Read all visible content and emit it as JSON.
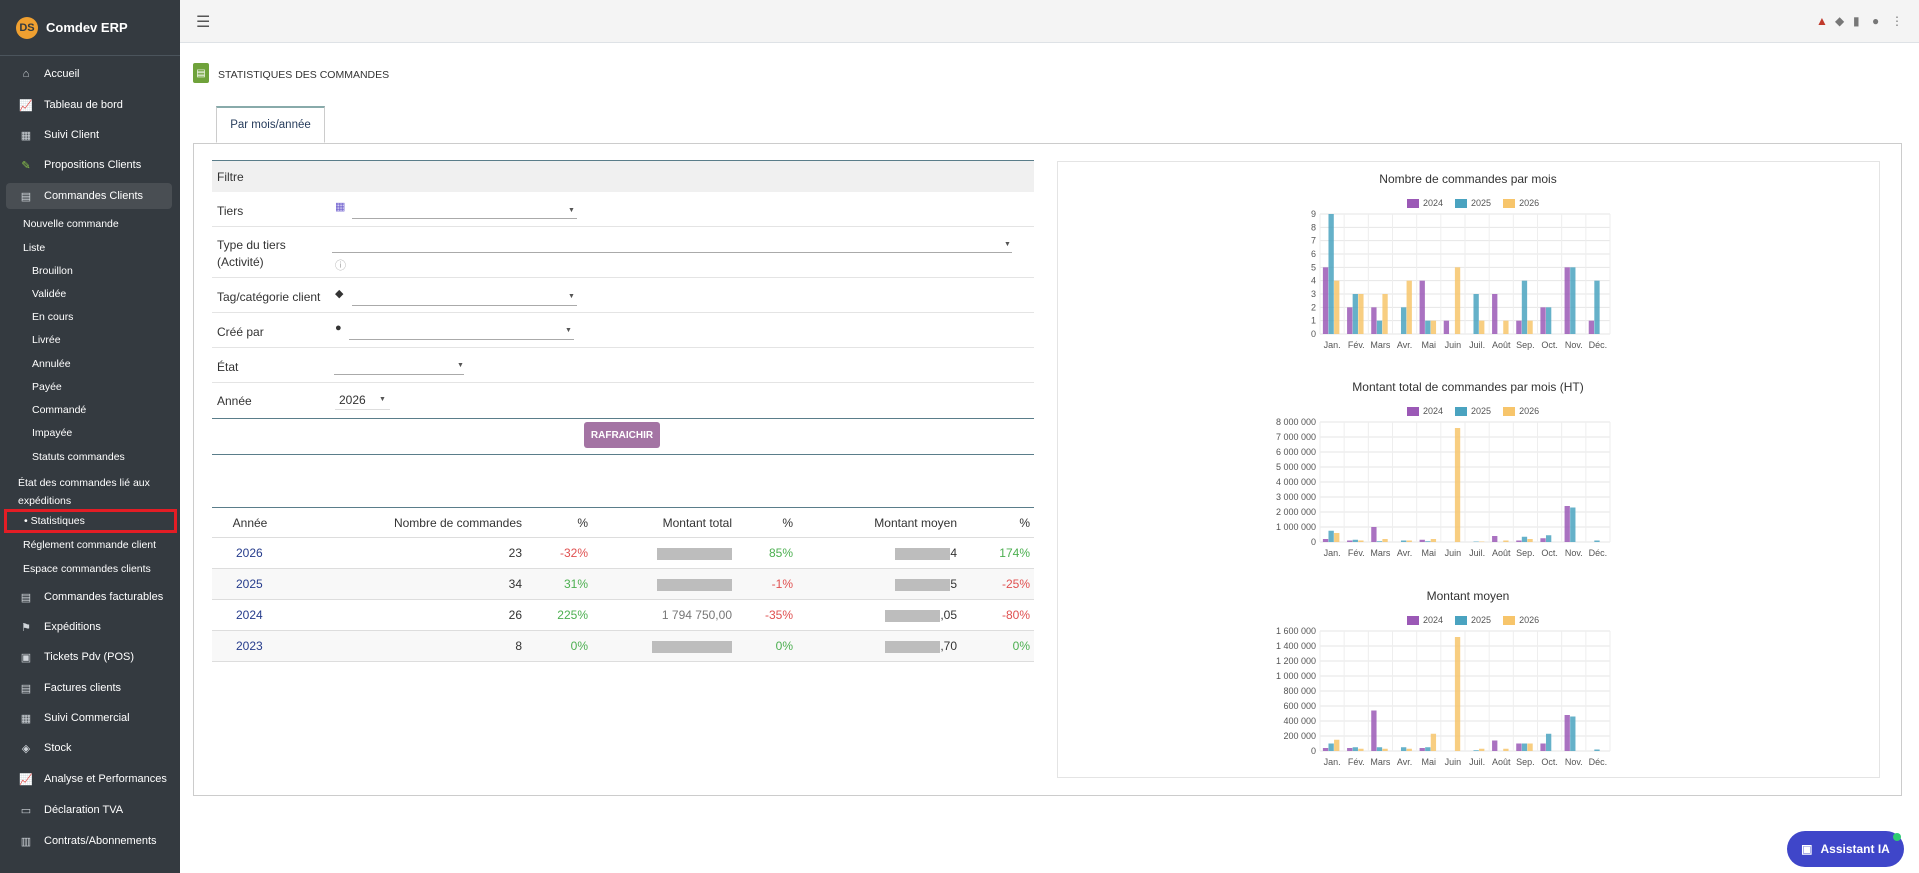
{
  "app": {
    "brand": "Comdev ERP",
    "logo": "DS"
  },
  "sidebar": {
    "items": [
      {
        "label": "Accueil",
        "icon": "home-icon",
        "glyph": "⌂"
      },
      {
        "label": "Tableau de bord",
        "icon": "chart-line-icon",
        "glyph": "📈"
      },
      {
        "label": "Suivi Client",
        "icon": "building-icon",
        "glyph": "▦"
      },
      {
        "label": "Propositions Clients",
        "icon": "edit-icon",
        "glyph": "✎"
      },
      {
        "label": "Commandes Clients",
        "icon": "document-icon",
        "glyph": "▤"
      },
      {
        "label": "Commandes facturables",
        "icon": "document-icon",
        "glyph": "▤"
      },
      {
        "label": "Expéditions",
        "icon": "dolly-icon",
        "glyph": "⚑"
      },
      {
        "label": "Tickets Pdv (POS)",
        "icon": "cash-register-icon",
        "glyph": "▣"
      },
      {
        "label": "Factures clients",
        "icon": "invoice-icon",
        "glyph": "▤"
      },
      {
        "label": "Suivi Commercial",
        "icon": "building-icon",
        "glyph": "▦"
      },
      {
        "label": "Stock",
        "icon": "box-icon",
        "glyph": "◈"
      },
      {
        "label": "Analyse et Performances",
        "icon": "chart-line-icon",
        "glyph": "📈"
      },
      {
        "label": "Déclaration TVA",
        "icon": "id-card-icon",
        "glyph": "▭"
      },
      {
        "label": "Contrats/Abonnements",
        "icon": "briefcase-icon",
        "glyph": "▥"
      }
    ],
    "sub": {
      "nouvelle": "Nouvelle commande",
      "liste": "Liste",
      "statuses": [
        "Brouillon",
        "Validée",
        "En cours",
        "Livrée",
        "Annulée",
        "Payée",
        "Commandé",
        "Impayée",
        "Statuts commandes"
      ],
      "expeditions": "État des commandes lié aux expéditions",
      "statistiques": "Statistiques",
      "reglement": "Réglement commande client",
      "espace": "Espace commandes clients"
    }
  },
  "page": {
    "title": "STATISTIQUES DES COMMANDES",
    "tab": "Par mois/année"
  },
  "filter": {
    "header": "Filtre",
    "tiers": "Tiers",
    "type_tiers": "Type du tiers (Activité)",
    "tag": "Tag/catégorie client",
    "cree_par": "Créé par",
    "etat": "État",
    "annee": "Année",
    "annee_value": "2026",
    "refresh": "RAFRAICHIR"
  },
  "stats": {
    "headers": [
      "Année",
      "Nombre de commandes",
      "%",
      "Montant total",
      "%",
      "Montant moyen",
      "%"
    ],
    "rows": [
      {
        "year": "2026",
        "count": "23",
        "pct1": "-32%",
        "total_visible": "",
        "pct2": "85%",
        "avg_visible": "4",
        "pct3": "174%"
      },
      {
        "year": "2025",
        "count": "34",
        "pct1": "31%",
        "total_visible": "",
        "pct2": "-1%",
        "avg_visible": "5",
        "pct3": "-25%"
      },
      {
        "year": "2024",
        "count": "26",
        "pct1": "225%",
        "total_visible": "1 794 750,00",
        "pct2": "-35%",
        "avg_visible": ",05",
        "pct3": "-80%"
      },
      {
        "year": "2023",
        "count": "8",
        "pct1": "0%",
        "total_visible": "",
        "pct2": "0%",
        "avg_visible": ",70",
        "pct3": "0%"
      }
    ]
  },
  "colors": {
    "s2024": "#9b59b6",
    "s2025": "#4aa3c0",
    "s2026": "#f7c56b",
    "sidebar": "#343a40",
    "highlight": "#e31d25"
  },
  "chart_data": [
    {
      "type": "bar",
      "title": "Nombre de commandes par mois",
      "categories": [
        "Jan.",
        "Fév.",
        "Mars",
        "Avr.",
        "Mai",
        "Juin",
        "Juil.",
        "Août",
        "Sep.",
        "Oct.",
        "Nov.",
        "Déc."
      ],
      "ylim": [
        0,
        9
      ],
      "yticks": [
        "0",
        "1",
        "2",
        "3",
        "4",
        "5",
        "6",
        "7",
        "8",
        "9"
      ],
      "series": [
        {
          "name": "2024",
          "values": [
            5,
            2,
            2,
            0,
            4,
            1,
            0,
            3,
            1,
            2,
            5,
            1
          ]
        },
        {
          "name": "2025",
          "values": [
            9,
            3,
            1,
            2,
            1,
            0,
            3,
            0,
            4,
            2,
            5,
            4
          ]
        },
        {
          "name": "2026",
          "values": [
            4,
            3,
            3,
            4,
            1,
            5,
            1,
            1,
            1,
            0,
            0,
            0
          ]
        }
      ]
    },
    {
      "type": "bar",
      "title": "Montant total de commandes par mois (HT)",
      "categories": [
        "Jan.",
        "Fév.",
        "Mars",
        "Avr.",
        "Mai",
        "Juin",
        "Juil.",
        "Août",
        "Sep.",
        "Oct.",
        "Nov.",
        "Déc."
      ],
      "ylim": [
        0,
        8000000
      ],
      "yticks": [
        "0",
        "1 000 000",
        "2 000 000",
        "3 000 000",
        "4 000 000",
        "5 000 000",
        "6 000 000",
        "7 000 000",
        "8 000 000"
      ],
      "series": [
        {
          "name": "2024",
          "values": [
            200000,
            100000,
            1000000,
            0,
            150000,
            0,
            0,
            400000,
            100000,
            250000,
            2400000,
            0
          ]
        },
        {
          "name": "2025",
          "values": [
            750000,
            150000,
            50000,
            100000,
            50000,
            0,
            30000,
            0,
            350000,
            450000,
            2300000,
            100000
          ]
        },
        {
          "name": "2026",
          "values": [
            600000,
            100000,
            200000,
            100000,
            200000,
            7600000,
            30000,
            100000,
            200000,
            0,
            0,
            0
          ]
        }
      ]
    },
    {
      "type": "bar",
      "title": "Montant moyen",
      "categories": [
        "Jan.",
        "Fév.",
        "Mars",
        "Avr.",
        "Mai",
        "Juin",
        "Juil.",
        "Août",
        "Sep.",
        "Oct.",
        "Nov.",
        "Déc."
      ],
      "ylim": [
        0,
        1600000
      ],
      "yticks": [
        "0",
        "200 000",
        "400 000",
        "600 000",
        "800 000",
        "1 000 000",
        "1 200 000",
        "1 400 000",
        "1 600 000"
      ],
      "series": [
        {
          "name": "2024",
          "values": [
            40000,
            40000,
            540000,
            0,
            40000,
            0,
            0,
            140000,
            100000,
            100000,
            480000,
            0
          ]
        },
        {
          "name": "2025",
          "values": [
            100000,
            50000,
            50000,
            50000,
            50000,
            0,
            10000,
            0,
            100000,
            230000,
            460000,
            20000
          ]
        },
        {
          "name": "2026",
          "values": [
            150000,
            30000,
            30000,
            30000,
            230000,
            1520000,
            30000,
            30000,
            100000,
            0,
            0,
            0
          ]
        }
      ]
    }
  ],
  "assistant": {
    "label": "Assistant IA"
  }
}
